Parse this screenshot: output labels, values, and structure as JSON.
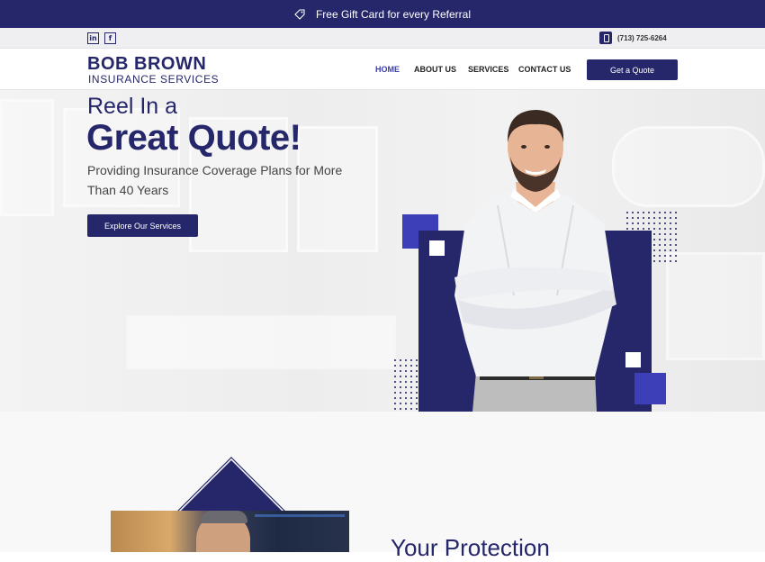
{
  "promo": {
    "text": "Free Gift Card for every Referral"
  },
  "social": {
    "linkedin": "in",
    "facebook": "f"
  },
  "contact": {
    "phone": "(713) 725-6264"
  },
  "logo": {
    "line1": "BOB BROWN",
    "line2": "INSURANCE SERVICES"
  },
  "nav": {
    "items": [
      "HOME",
      "ABOUT US",
      "SERVICES",
      "CONTACT US"
    ],
    "cta": "Get a Quote"
  },
  "hero": {
    "kicker": "Reel In a",
    "headline": "Great Quote!",
    "subtext": "Providing Insurance Coverage Plans for More Than 40 Years",
    "button": "Explore Our Services"
  },
  "section2": {
    "heading": "Your Protection"
  },
  "colors": {
    "brand": "#25276a",
    "accent": "#3d3fb8"
  }
}
